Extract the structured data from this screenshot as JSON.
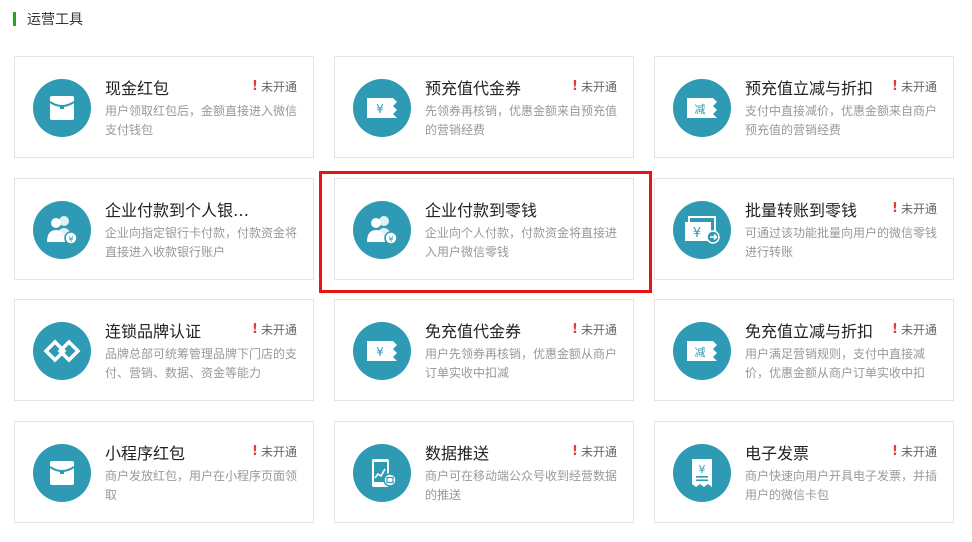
{
  "section": {
    "title": "运营工具"
  },
  "status_label": "未开通",
  "colors": {
    "accent": "#1aad19",
    "icon_bg": "#2e9ab4",
    "warning": "#e0403c",
    "highlight": "#e81313"
  },
  "cards": [
    {
      "title": "现金红包",
      "status": "未开通",
      "desc": "用户领取红包后，金额直接进入微信支付钱包",
      "icon": "red-packet-icon"
    },
    {
      "title": "预充值代金券",
      "status": "未开通",
      "desc": "先领券再核销，优惠金额来自预充值的营销经费",
      "icon": "yuan-coupon-icon"
    },
    {
      "title": "预充值立减与折扣",
      "status": "未开通",
      "desc": "支付中直接减价，优惠金额来自商户预充值的营销经费",
      "icon": "discount-icon"
    },
    {
      "title": "企业付款到个人银…",
      "status": "",
      "desc": "企业向指定银行卡付款，付款资金将直接进入收款银行账户",
      "icon": "users-payment-icon"
    },
    {
      "title": "企业付款到零钱",
      "status": "",
      "desc": "企业向个人付款，付款资金将直接进入用户微信零钱",
      "icon": "users-payment-icon"
    },
    {
      "title": "批量转账到零钱",
      "status": "未开通",
      "desc": "可通过该功能批量向用户的微信零钱进行转账",
      "icon": "batch-transfer-icon"
    },
    {
      "title": "连锁品牌认证",
      "status": "未开通",
      "desc": "品牌总部可统筹管理品牌下门店的支付、营销、数据、资金等能力",
      "icon": "brand-chain-icon"
    },
    {
      "title": "免充值代金券",
      "status": "未开通",
      "desc": "用户先领券再核销，优惠金额从商户订单实收中扣减",
      "icon": "yuan-coupon-icon"
    },
    {
      "title": "免充值立减与折扣",
      "status": "未开通",
      "desc": "用户满足营销规则，支付中直接减价，优惠金额从商户订单实收中扣",
      "icon": "discount-icon"
    },
    {
      "title": "小程序红包",
      "status": "未开通",
      "desc": "商户发放红包，用户在小程序页面领取",
      "icon": "red-packet-icon"
    },
    {
      "title": "数据推送",
      "status": "未开通",
      "desc": "商户可在移动端公众号收到经营数据的推送",
      "icon": "data-push-icon"
    },
    {
      "title": "电子发票",
      "status": "未开通",
      "desc": "商户快速向用户开具电子发票，并插用户的微信卡包",
      "icon": "invoice-icon"
    }
  ],
  "icon_text": {
    "yuan": "¥",
    "jian": "减"
  }
}
